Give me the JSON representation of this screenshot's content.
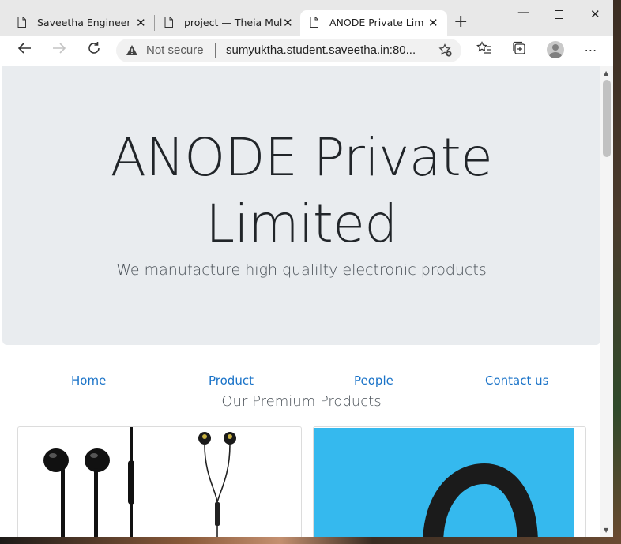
{
  "browser": {
    "tabs": [
      {
        "label": "Saveetha Engineering"
      },
      {
        "label": "project — Theia Multi"
      },
      {
        "label": "ANODE Private Limited"
      }
    ],
    "address_bar": {
      "security_label": "Not secure",
      "url": "sumyuktha.student.saveetha.in:80..."
    }
  },
  "page": {
    "jumbotron": {
      "title_line1": "ANODE Private",
      "title_line2": "Limited",
      "lead": "We manufacture high qualilty electronic products"
    },
    "nav": [
      {
        "label": "Home"
      },
      {
        "label": "Product"
      },
      {
        "label": "People"
      },
      {
        "label": "Contact us"
      }
    ],
    "section_title": "Our Premium Products"
  },
  "colors": {
    "jumbotron_bg": "#e9ecef",
    "link": "#1a73c8",
    "product_bg_blue": "#35b9ee"
  },
  "icons": [
    "page-icon",
    "close-icon",
    "plus-icon",
    "minimize-icon",
    "maximize-icon",
    "back-icon",
    "forward-icon",
    "refresh-icon",
    "warning-icon",
    "favorite-add-icon",
    "favorites-icon",
    "collections-icon",
    "profile-icon",
    "more-icon"
  ]
}
